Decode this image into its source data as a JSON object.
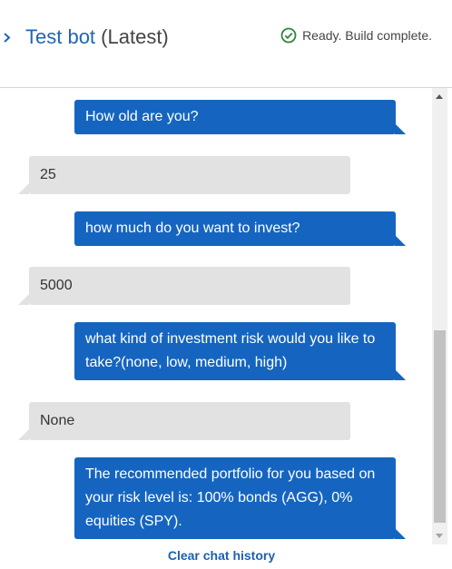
{
  "header": {
    "bot_name": "Test bot",
    "version_label": "(Latest)",
    "status_text": "Ready. Build complete.",
    "toggle_icon": "chevron-right-icon",
    "status_icon": "check-circle-icon"
  },
  "chat": {
    "messages": [
      {
        "sender": "bot",
        "text": "How old are you?"
      },
      {
        "sender": "user",
        "text": "25"
      },
      {
        "sender": "bot",
        "text": "how much do you want to invest?"
      },
      {
        "sender": "user",
        "text": "5000"
      },
      {
        "sender": "bot",
        "text": "what kind of investment risk would you like to take?(none, low, medium, high)"
      },
      {
        "sender": "user",
        "text": "None"
      },
      {
        "sender": "bot",
        "text": "The recommended portfolio for you based on your risk level is: 100% bonds (AGG), 0% equities (SPY)."
      }
    ]
  },
  "footer": {
    "clear_label": "Clear chat history"
  },
  "colors": {
    "accent": "#1565c0",
    "user_bubble": "#e2e2e2",
    "status_green": "#2e8540"
  }
}
